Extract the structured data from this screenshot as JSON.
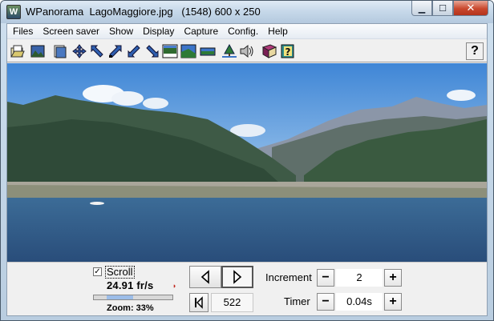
{
  "window": {
    "title": "WPanorama  LagoMaggiore.jpg   (1548) 600 x 250",
    "app_icon_letter": "W",
    "minimize_glyph": "▁",
    "maximize_glyph": "☐",
    "close_glyph": "✕"
  },
  "menu": {
    "items": [
      "Files",
      "Screen saver",
      "Show",
      "Display",
      "Capture",
      "Config.",
      "Help"
    ]
  },
  "toolbar": {
    "icons": [
      "open-file-icon",
      "picture-icon",
      "fit-page-icon",
      "move-arrows-icon",
      "scroll-left-up-icon",
      "scroll-right-up-icon",
      "scroll-left-down-icon",
      "scroll-right-down-icon",
      "image-strip-icon",
      "landscape-icon",
      "narrow-landscape-icon",
      "tree-icon",
      "speaker-icon",
      "book-icon",
      "help-book-icon"
    ],
    "help_label": "?"
  },
  "controls": {
    "scroll_checked": true,
    "scroll_check_glyph": "✓",
    "scroll_label": "Scroll",
    "fps": "24.91 fr/s",
    "fps_indicator_glyph": "◗",
    "zoom_level": 0.33,
    "zoom_label": "Zoom: 33%",
    "frame_number": "522",
    "increment_label": "Increment",
    "increment_value": "2",
    "timer_label": "Timer",
    "timer_value": "0.04s",
    "minus_glyph": "−",
    "plus_glyph": "+"
  }
}
